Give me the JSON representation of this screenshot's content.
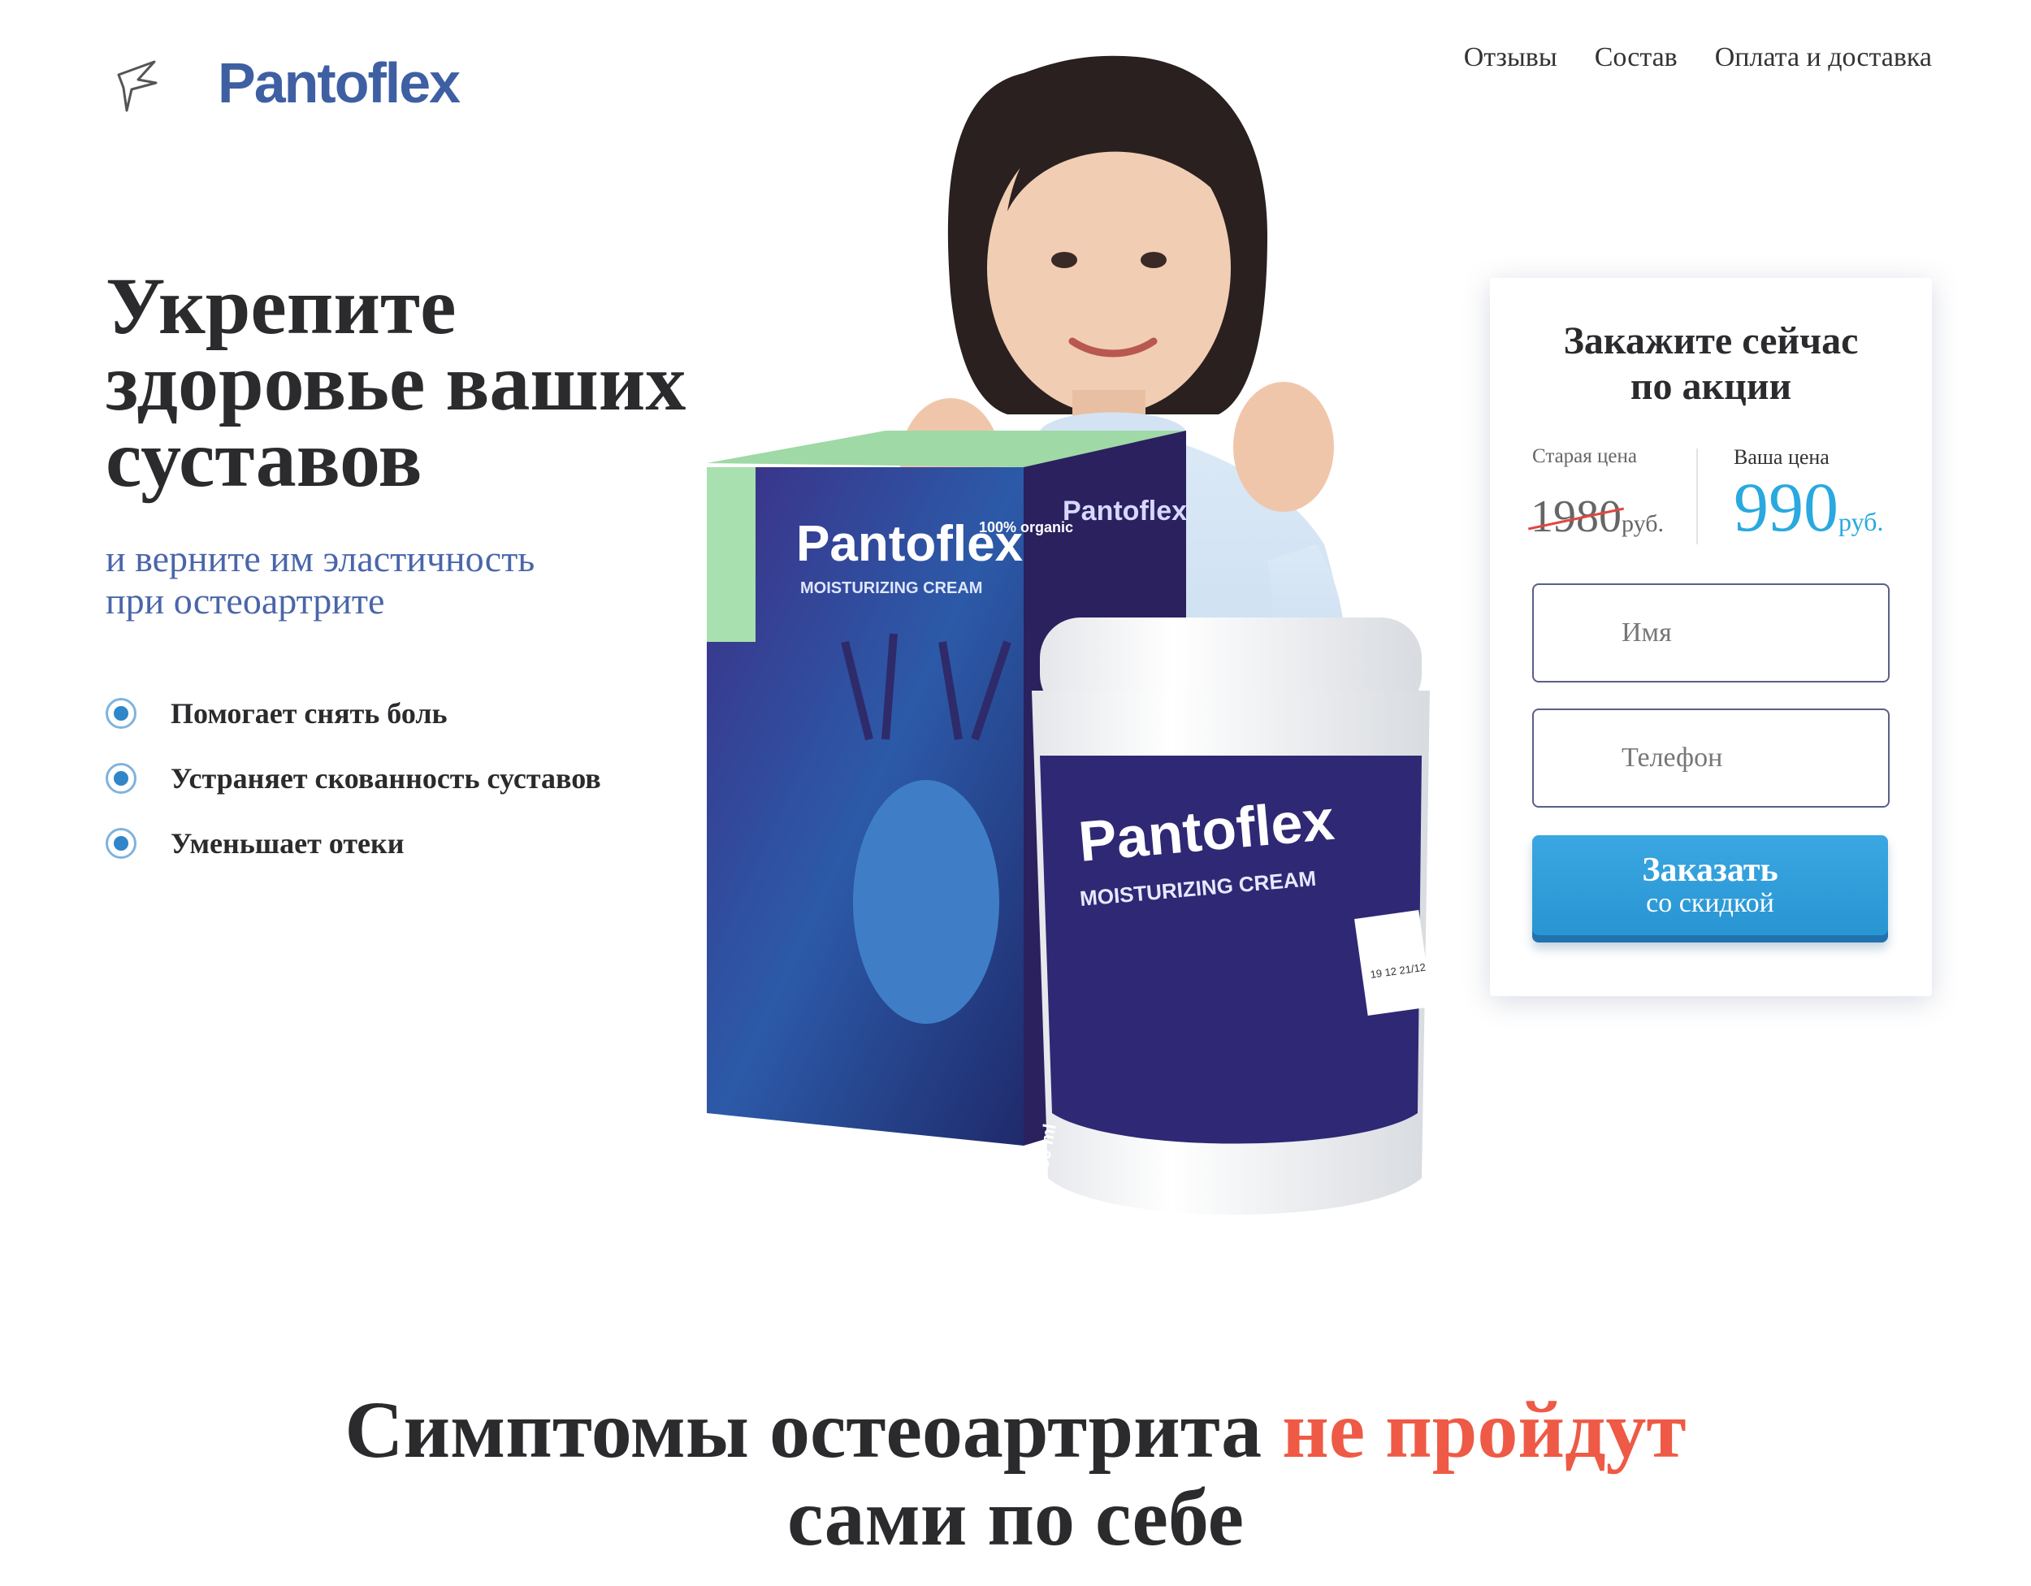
{
  "header": {
    "logo_text": "Pantoflex",
    "nav": [
      "Отзывы",
      "Состав",
      "Оплата и доставка"
    ]
  },
  "hero": {
    "title_lines": [
      "Укрепите",
      "здоровье ваших",
      "суставов"
    ],
    "subtitle_lines": [
      "и верните им эластичность",
      "при остеоартрите"
    ],
    "benefits": [
      "Помогает снять боль",
      "Устраняет скованность суставов",
      "Уменьшает отеки"
    ]
  },
  "product": {
    "box_brand": "Pantoflex",
    "box_sub": "MOISTURIZING CREAM",
    "box_badge": "100% organic",
    "box_side": "Pantoflex",
    "jar_volume": "50 ml",
    "jar_brand": "Pantoflex",
    "jar_sub": "MOISTURIZING CREAM",
    "jar_date": "19 12 21/12"
  },
  "order": {
    "title_lines": [
      "Закажите сейчас",
      "по акции"
    ],
    "old_label": "Старая цена",
    "old_price": "1980",
    "currency": "руб.",
    "new_label": "Ваша цена",
    "new_price": "990",
    "name_placeholder": "Имя",
    "phone_placeholder": "Телефон",
    "button_line1": "Заказать",
    "button_line2": "со скидкой"
  },
  "symptoms": {
    "part1": "Симптомы остеоартрита ",
    "accent": "не пройдут",
    "line2": "сами по себе"
  },
  "colors": {
    "brand_blue": "#3f5fa3",
    "price_blue": "#29a9df",
    "accent_red": "#ee5a45",
    "button": "#2f9ed8"
  }
}
